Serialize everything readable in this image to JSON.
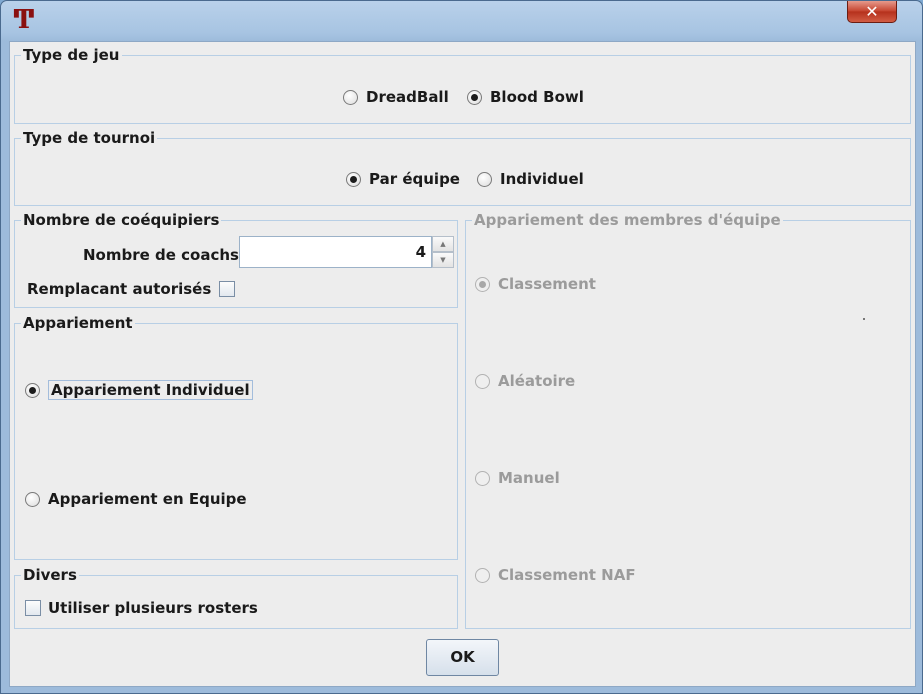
{
  "window": {
    "title_icon": "tournament-T-icon",
    "close_glyph": "✕"
  },
  "type_jeu": {
    "title": "Type de jeu",
    "options": [
      {
        "label": "DreadBall",
        "selected": false
      },
      {
        "label": "Blood Bowl",
        "selected": true
      }
    ]
  },
  "type_tournoi": {
    "title": "Type de tournoi",
    "options": [
      {
        "label": "Par équipe",
        "selected": true
      },
      {
        "label": "Individuel",
        "selected": false
      }
    ]
  },
  "coequipiers": {
    "title": "Nombre de coéquipiers",
    "coachs_label": "Nombre de coachs",
    "coachs_value": "4",
    "remplacant_label": "Remplacant autorisés",
    "remplacant_checked": false
  },
  "appariement": {
    "title": "Appariement",
    "options": [
      {
        "label": "Appariement Individuel",
        "selected": true
      },
      {
        "label": "Appariement en Equipe",
        "selected": false
      }
    ]
  },
  "divers": {
    "title": "Divers",
    "rosters_label": "Utiliser plusieurs rosters",
    "rosters_checked": false
  },
  "appariement_membres": {
    "title": "Appariement des membres d'équipe",
    "enabled": false,
    "options": [
      {
        "label": "Classement",
        "selected": true
      },
      {
        "label": "Aléatoire",
        "selected": false
      },
      {
        "label": "Manuel",
        "selected": false
      },
      {
        "label": "Classement NAF",
        "selected": false
      }
    ]
  },
  "buttons": {
    "ok": "OK"
  },
  "colors": {
    "title_bar": "#a7c4e2",
    "close_button": "#c4412c",
    "dialog_background": "#ededed",
    "group_border": "#b8cfe5",
    "disabled_text": "#9b9b9b"
  }
}
